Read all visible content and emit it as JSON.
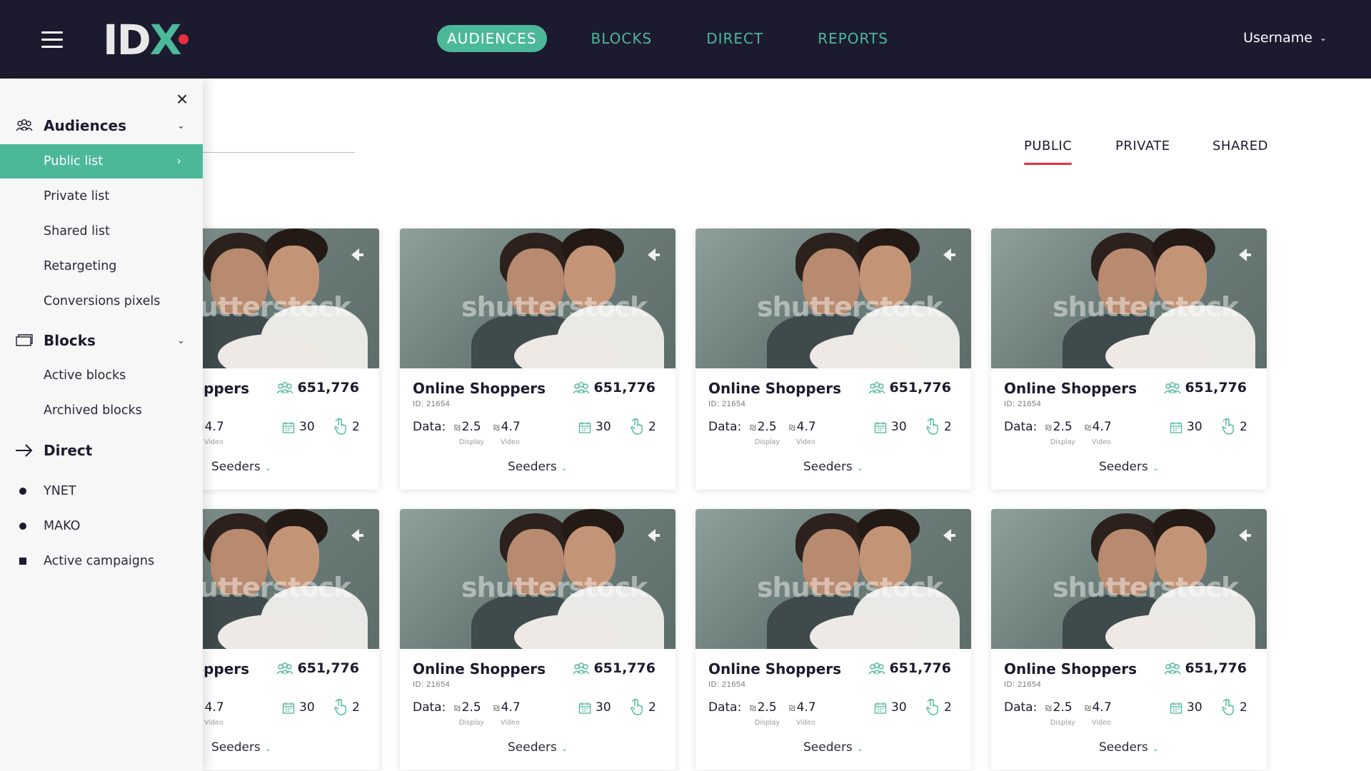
{
  "header": {
    "logo_text": "IDX",
    "nav": [
      {
        "label": "AUDIENCES",
        "active": true
      },
      {
        "label": "BLOCKS",
        "active": false
      },
      {
        "label": "DIRECT",
        "active": false
      },
      {
        "label": "REPORTS",
        "active": false
      }
    ],
    "username": "Username"
  },
  "sidebar": {
    "sections": [
      {
        "label": "Audiences",
        "icon": "audience-icon"
      },
      {
        "label": "Blocks",
        "icon": "blocks-icon"
      },
      {
        "label": "Direct",
        "icon": "arrow-right-icon"
      }
    ],
    "audience_items": [
      "Public list",
      "Private list",
      "Shared list",
      "Retargeting",
      "Conversions pixels"
    ],
    "block_items": [
      "Active blocks",
      "Archived blocks"
    ],
    "direct_items": [
      "YNET",
      "MAKO",
      "Active campaigns"
    ]
  },
  "tabs": [
    {
      "label": "PUBLIC",
      "active": true
    },
    {
      "label": "PRIVATE",
      "active": false
    },
    {
      "label": "SHARED",
      "active": false
    }
  ],
  "card": {
    "title": "Online Shoppers",
    "id_text": "ID: 21654",
    "count": "651,776",
    "data_label": "Data:",
    "currency": "₪",
    "display_value": "2.5",
    "display_label": "Display",
    "video_value": "4.7",
    "video_label": "Video",
    "days": "30",
    "clicks": "2",
    "seeders_label": "Seeders",
    "watermark": "shutterstock"
  },
  "colors": {
    "accent": "#4cb89a",
    "dark": "#1c1a2e",
    "red": "#e8313f"
  }
}
